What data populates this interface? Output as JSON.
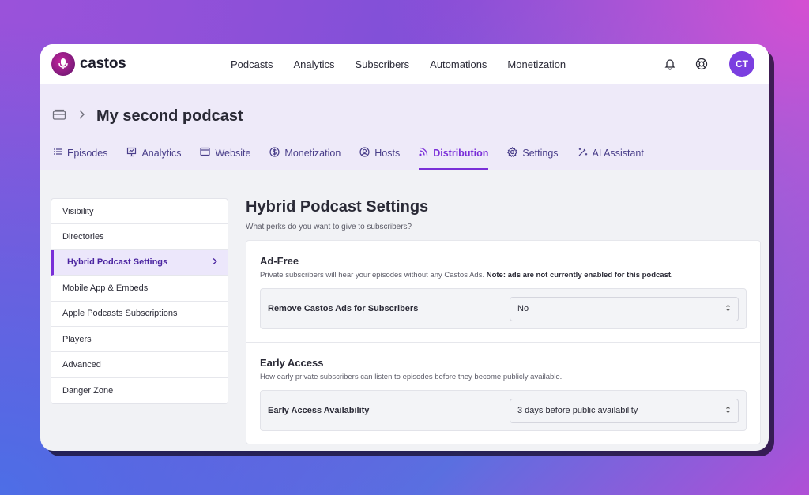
{
  "brand": {
    "name": "castos"
  },
  "topnav": {
    "items": [
      "Podcasts",
      "Analytics",
      "Subscribers",
      "Automations",
      "Monetization"
    ],
    "avatar_initials": "CT"
  },
  "header": {
    "title": "My second podcast",
    "tabs": [
      {
        "label": "Episodes",
        "icon": "list-icon"
      },
      {
        "label": "Analytics",
        "icon": "presentation-icon"
      },
      {
        "label": "Website",
        "icon": "browser-icon"
      },
      {
        "label": "Monetization",
        "icon": "dollar-icon"
      },
      {
        "label": "Hosts",
        "icon": "user-circle-icon"
      },
      {
        "label": "Distribution",
        "icon": "rss-icon",
        "active": true
      },
      {
        "label": "Settings",
        "icon": "gear-icon"
      },
      {
        "label": "AI Assistant",
        "icon": "magic-wand-icon"
      }
    ]
  },
  "sidebar": {
    "items": [
      {
        "label": "Visibility"
      },
      {
        "label": "Directories"
      },
      {
        "label": "Hybrid Podcast Settings",
        "active": true
      },
      {
        "label": "Mobile App & Embeds"
      },
      {
        "label": "Apple Podcasts Subscriptions"
      },
      {
        "label": "Players"
      },
      {
        "label": "Advanced"
      },
      {
        "label": "Danger Zone"
      }
    ]
  },
  "main": {
    "title": "Hybrid Podcast Settings",
    "subtitle": "What perks do you want to give to subscribers?",
    "sections": [
      {
        "title": "Ad-Free",
        "desc": "Private subscribers will hear your episodes without any Castos Ads.",
        "desc_note": "Note: ads are not currently enabled for this podcast.",
        "field_label": "Remove Castos Ads for Subscribers",
        "select_value": "No"
      },
      {
        "title": "Early Access",
        "desc": "How early private subscribers can listen to episodes before they become publicly available.",
        "field_label": "Early Access Availability",
        "select_value": "3 days before public availability"
      }
    ]
  },
  "colors": {
    "accent": "#7a2fd8",
    "brand": "#b0208f",
    "header_bg": "#eeeaf9"
  }
}
